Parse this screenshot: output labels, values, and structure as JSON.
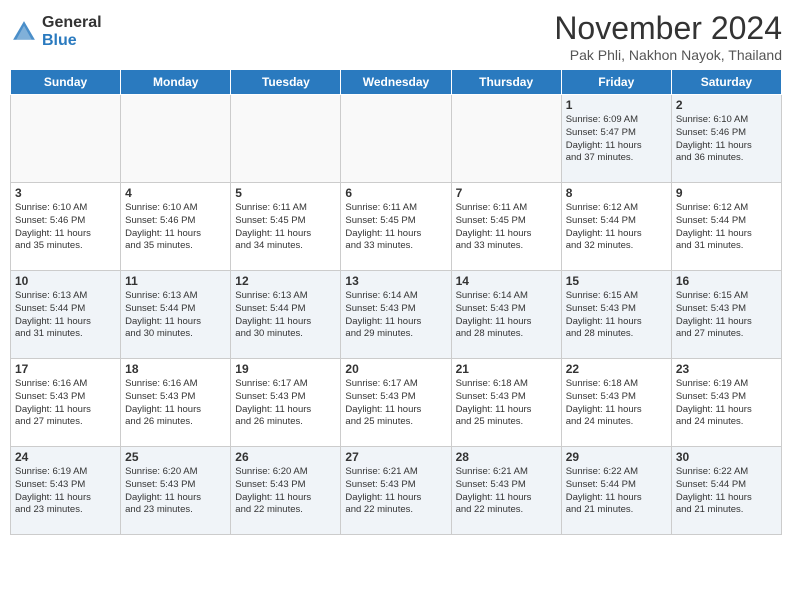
{
  "logo": {
    "general": "General",
    "blue": "Blue"
  },
  "title": "November 2024",
  "subtitle": "Pak Phli, Nakhon Nayok, Thailand",
  "weekdays": [
    "Sunday",
    "Monday",
    "Tuesday",
    "Wednesday",
    "Thursday",
    "Friday",
    "Saturday"
  ],
  "weeks": [
    [
      {
        "day": "",
        "info": ""
      },
      {
        "day": "",
        "info": ""
      },
      {
        "day": "",
        "info": ""
      },
      {
        "day": "",
        "info": ""
      },
      {
        "day": "",
        "info": ""
      },
      {
        "day": "1",
        "info": "Sunrise: 6:09 AM\nSunset: 5:47 PM\nDaylight: 11 hours\nand 37 minutes."
      },
      {
        "day": "2",
        "info": "Sunrise: 6:10 AM\nSunset: 5:46 PM\nDaylight: 11 hours\nand 36 minutes."
      }
    ],
    [
      {
        "day": "3",
        "info": "Sunrise: 6:10 AM\nSunset: 5:46 PM\nDaylight: 11 hours\nand 35 minutes."
      },
      {
        "day": "4",
        "info": "Sunrise: 6:10 AM\nSunset: 5:46 PM\nDaylight: 11 hours\nand 35 minutes."
      },
      {
        "day": "5",
        "info": "Sunrise: 6:11 AM\nSunset: 5:45 PM\nDaylight: 11 hours\nand 34 minutes."
      },
      {
        "day": "6",
        "info": "Sunrise: 6:11 AM\nSunset: 5:45 PM\nDaylight: 11 hours\nand 33 minutes."
      },
      {
        "day": "7",
        "info": "Sunrise: 6:11 AM\nSunset: 5:45 PM\nDaylight: 11 hours\nand 33 minutes."
      },
      {
        "day": "8",
        "info": "Sunrise: 6:12 AM\nSunset: 5:44 PM\nDaylight: 11 hours\nand 32 minutes."
      },
      {
        "day": "9",
        "info": "Sunrise: 6:12 AM\nSunset: 5:44 PM\nDaylight: 11 hours\nand 31 minutes."
      }
    ],
    [
      {
        "day": "10",
        "info": "Sunrise: 6:13 AM\nSunset: 5:44 PM\nDaylight: 11 hours\nand 31 minutes."
      },
      {
        "day": "11",
        "info": "Sunrise: 6:13 AM\nSunset: 5:44 PM\nDaylight: 11 hours\nand 30 minutes."
      },
      {
        "day": "12",
        "info": "Sunrise: 6:13 AM\nSunset: 5:44 PM\nDaylight: 11 hours\nand 30 minutes."
      },
      {
        "day": "13",
        "info": "Sunrise: 6:14 AM\nSunset: 5:43 PM\nDaylight: 11 hours\nand 29 minutes."
      },
      {
        "day": "14",
        "info": "Sunrise: 6:14 AM\nSunset: 5:43 PM\nDaylight: 11 hours\nand 28 minutes."
      },
      {
        "day": "15",
        "info": "Sunrise: 6:15 AM\nSunset: 5:43 PM\nDaylight: 11 hours\nand 28 minutes."
      },
      {
        "day": "16",
        "info": "Sunrise: 6:15 AM\nSunset: 5:43 PM\nDaylight: 11 hours\nand 27 minutes."
      }
    ],
    [
      {
        "day": "17",
        "info": "Sunrise: 6:16 AM\nSunset: 5:43 PM\nDaylight: 11 hours\nand 27 minutes."
      },
      {
        "day": "18",
        "info": "Sunrise: 6:16 AM\nSunset: 5:43 PM\nDaylight: 11 hours\nand 26 minutes."
      },
      {
        "day": "19",
        "info": "Sunrise: 6:17 AM\nSunset: 5:43 PM\nDaylight: 11 hours\nand 26 minutes."
      },
      {
        "day": "20",
        "info": "Sunrise: 6:17 AM\nSunset: 5:43 PM\nDaylight: 11 hours\nand 25 minutes."
      },
      {
        "day": "21",
        "info": "Sunrise: 6:18 AM\nSunset: 5:43 PM\nDaylight: 11 hours\nand 25 minutes."
      },
      {
        "day": "22",
        "info": "Sunrise: 6:18 AM\nSunset: 5:43 PM\nDaylight: 11 hours\nand 24 minutes."
      },
      {
        "day": "23",
        "info": "Sunrise: 6:19 AM\nSunset: 5:43 PM\nDaylight: 11 hours\nand 24 minutes."
      }
    ],
    [
      {
        "day": "24",
        "info": "Sunrise: 6:19 AM\nSunset: 5:43 PM\nDaylight: 11 hours\nand 23 minutes."
      },
      {
        "day": "25",
        "info": "Sunrise: 6:20 AM\nSunset: 5:43 PM\nDaylight: 11 hours\nand 23 minutes."
      },
      {
        "day": "26",
        "info": "Sunrise: 6:20 AM\nSunset: 5:43 PM\nDaylight: 11 hours\nand 22 minutes."
      },
      {
        "day": "27",
        "info": "Sunrise: 6:21 AM\nSunset: 5:43 PM\nDaylight: 11 hours\nand 22 minutes."
      },
      {
        "day": "28",
        "info": "Sunrise: 6:21 AM\nSunset: 5:43 PM\nDaylight: 11 hours\nand 22 minutes."
      },
      {
        "day": "29",
        "info": "Sunrise: 6:22 AM\nSunset: 5:44 PM\nDaylight: 11 hours\nand 21 minutes."
      },
      {
        "day": "30",
        "info": "Sunrise: 6:22 AM\nSunset: 5:44 PM\nDaylight: 11 hours\nand 21 minutes."
      }
    ]
  ]
}
